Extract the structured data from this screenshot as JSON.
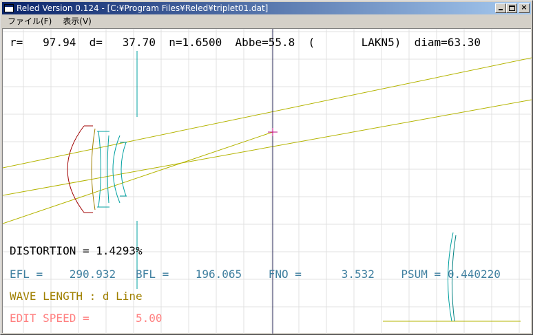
{
  "window": {
    "title": "Reled Version 0.124 - [C:¥Program Files¥Reled¥triplet01.dat]",
    "min_glyph": "_",
    "close_glyph": "×"
  },
  "menu": {
    "items": [
      {
        "label": "ファイル(F)"
      },
      {
        "label": "表示(V)"
      }
    ]
  },
  "surface_info": {
    "r_label": "r=",
    "r_value": "97.94",
    "d_label": "d=",
    "d_value": "37.70",
    "n": "n=1.6500",
    "abbe": "Abbe=55.8",
    "glass": "(       LAKN5)",
    "diam": "diam=63.30"
  },
  "results": {
    "distortion_label": "DISTORTION =",
    "distortion_value": "1.4293%",
    "efl_label": "EFL =",
    "efl_value": "290.932",
    "bfl_label": "BFL =",
    "bfl_value": "196.065",
    "fno_label": "FNO =",
    "fno_value": "3.532",
    "psum_label": "PSUM = 0.440220",
    "wavelength_label": "WAVE LENGTH : d Line",
    "edit_speed_label": "EDIT SPEED =",
    "edit_speed_value": "5.00"
  },
  "colors": {
    "grid": "#e0e0e0",
    "ray": "#b4b400",
    "cursor_line": "#202050",
    "lens_red": "#a00000",
    "lens_olive": "#a08000",
    "lens_cyan": "#00a0a0",
    "lens_teal": "#008080",
    "text_black": "#000000",
    "text_blue": "#4080a0",
    "text_olive": "#a08000",
    "text_pink": "#ff8080"
  }
}
